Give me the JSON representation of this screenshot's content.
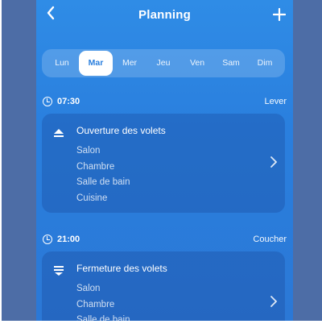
{
  "header": {
    "title": "Planning"
  },
  "days": [
    "Lun",
    "Mar",
    "Mer",
    "Jeu",
    "Ven",
    "Sam",
    "Dim"
  ],
  "active_day_index": 1,
  "schedules": [
    {
      "time": "07:30",
      "event": "Lever",
      "action": "Ouverture des volets",
      "icon": "blind-open-icon",
      "rooms": [
        "Salon",
        "Chambre",
        "Salle de bain",
        "Cuisine"
      ]
    },
    {
      "time": "21:00",
      "event": "Coucher",
      "action": "Fermeture des volets",
      "icon": "blind-close-icon",
      "rooms": [
        "Salon",
        "Chambre",
        "Salle de bain"
      ]
    }
  ],
  "colors": {
    "background": "#2a7fde",
    "active_day_text": "#2a7fde",
    "frame": "#4d6da6"
  }
}
